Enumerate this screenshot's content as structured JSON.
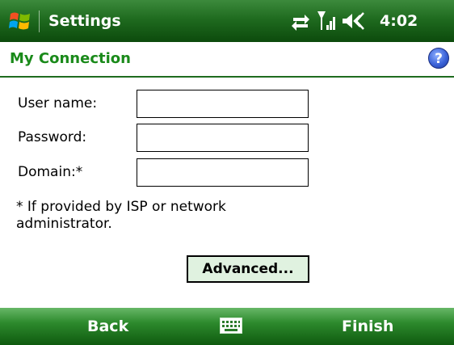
{
  "titlebar": {
    "app_title": "Settings",
    "clock": "4:02",
    "icons": [
      "windows-start-icon",
      "connectivity-icon",
      "signal-icon",
      "volume-icon"
    ]
  },
  "header": {
    "title": "My Connection",
    "help_icon": "help-icon",
    "help_glyph": "?"
  },
  "form": {
    "username_label": "User name:",
    "username_value": "",
    "password_label": "Password:",
    "password_value": "",
    "domain_label": "Domain:*",
    "domain_value": "",
    "note": "* If provided by ISP or network administrator.",
    "advanced_label": "Advanced..."
  },
  "softkeys": {
    "left": "Back",
    "right": "Finish",
    "center_icon": "keyboard-icon"
  },
  "colors": {
    "bar_green": "#1f6b1f",
    "header_text_green": "#1a8a1a",
    "button_fill": "#e0f2e0"
  }
}
